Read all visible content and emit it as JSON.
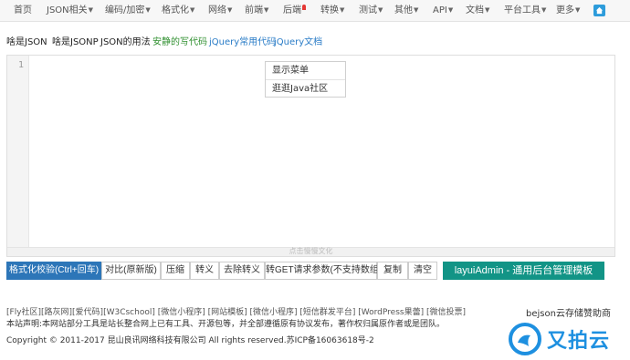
{
  "topnav": {
    "items": [
      {
        "label": "首页",
        "caret": false
      },
      {
        "label": "JSON相关",
        "caret": true
      },
      {
        "label": "编码/加密",
        "caret": true
      },
      {
        "label": "格式化",
        "caret": true
      },
      {
        "label": "网络",
        "caret": true
      },
      {
        "label": "前端",
        "caret": true
      },
      {
        "label": "后端",
        "caret": false,
        "pin": true
      },
      {
        "label": "转换",
        "caret": true
      },
      {
        "label": "测试",
        "caret": true
      },
      {
        "label": "其他",
        "caret": true
      },
      {
        "label": "API",
        "caret": true
      },
      {
        "label": "文档",
        "caret": true
      },
      {
        "label": "平台工具",
        "caret": true
      },
      {
        "label": "更多",
        "caret": true
      }
    ],
    "home_icon": "home-icon",
    "accent": "#2d9cdb"
  },
  "subnav": [
    {
      "label": "啥是JSON",
      "color": "default"
    },
    {
      "label": "啥是JSONP",
      "color": "default"
    },
    {
      "label": "JSON的用法",
      "color": "default"
    },
    {
      "label": "安静的写代码",
      "color": "green"
    },
    {
      "label": "jQuery常用代码",
      "color": "blue"
    },
    {
      "label": "jQuery文档",
      "color": "blue"
    }
  ],
  "editor": {
    "line_number": "1",
    "expand_hint": "点击慢慢文化"
  },
  "context_menu": [
    "显示菜单",
    "逛逛Java社区"
  ],
  "buttons": {
    "format": "格式化校验(Ctrl+回车)",
    "compare": "对比(原新版)",
    "compress": "压缩",
    "escape": "转义",
    "unescape": "去除转义",
    "to_get": "转GET请求参数(不支持数组)",
    "copy": "复制",
    "clear": "清空",
    "promo": "layuiAdmin - 通用后台管理模板"
  },
  "footer": {
    "links": "[Fly社区][路灰网][爱代码][W3Cschool] [微信小程序] [网站模板] [微信小程序] [短信群发平台] [WordPress果蕾] [微信投票]",
    "sponsor": "bejson云存储赞助商",
    "notice": "本站声明:本网站部分工具是站长整合网上已有工具、开源包等，并全部遵循原有协议发布，著作权归属原作者或是团队。",
    "copyright": "Copyright © 2011-2017 昆山良讯网络科技有限公司 All rights reserved.苏ICP备16063618号-2",
    "logo_text": "又拍云"
  },
  "colors": {
    "primary_button": "#2d76b8",
    "promo_button": "#129486",
    "logo": "#1e90e0"
  }
}
